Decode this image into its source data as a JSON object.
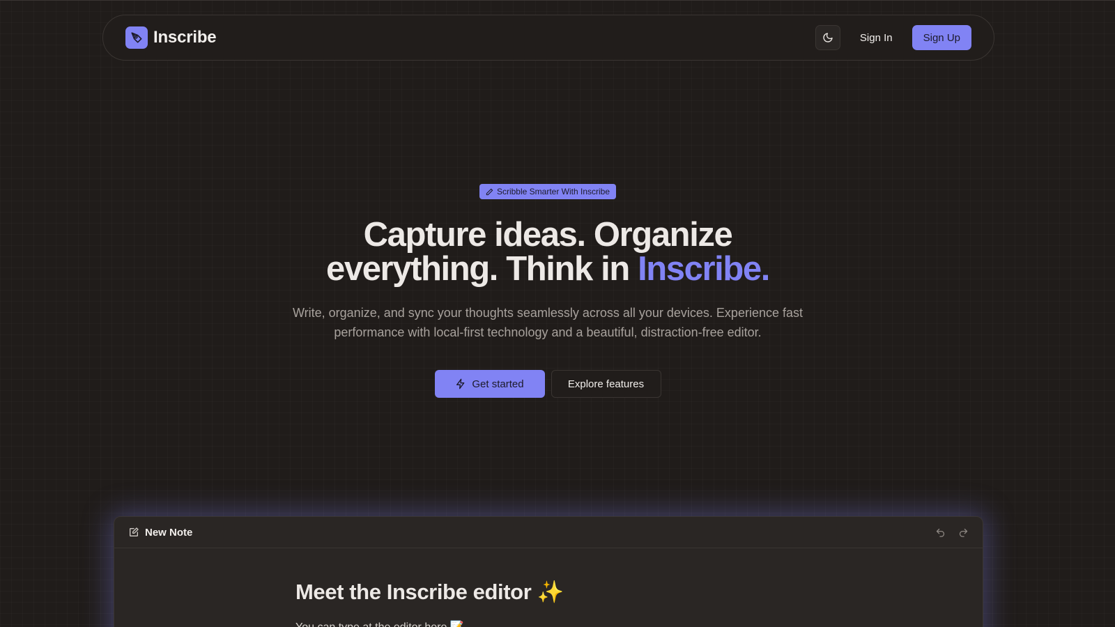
{
  "app": {
    "name": "Inscribe"
  },
  "nav": {
    "sign_in": "Sign In",
    "sign_up": "Sign Up"
  },
  "hero": {
    "badge": "Scribble Smarter With Inscribe",
    "headline_line1": "Capture ideas. Organize",
    "headline_line2": "everything. Think in ",
    "headline_accent": "Inscribe.",
    "subtitle": "Write, organize, and sync your thoughts seamlessly across all your devices. Experience fast performance with local-first technology and a beautiful, distraction-free editor.",
    "cta_primary": "Get started",
    "cta_secondary": "Explore features"
  },
  "editor": {
    "title": "New Note",
    "heading": "Meet the Inscribe editor ✨",
    "paragraph": "You can type at the editor here 📝"
  },
  "colors": {
    "background": "#201c1a",
    "accent": "#8183f4",
    "text": "#ede9e6",
    "muted": "#a8a29d"
  },
  "icons": [
    "logo-pen-icon",
    "moon-icon",
    "pencil-icon",
    "bolt-icon",
    "note-edit-icon",
    "undo-icon",
    "redo-icon"
  ]
}
